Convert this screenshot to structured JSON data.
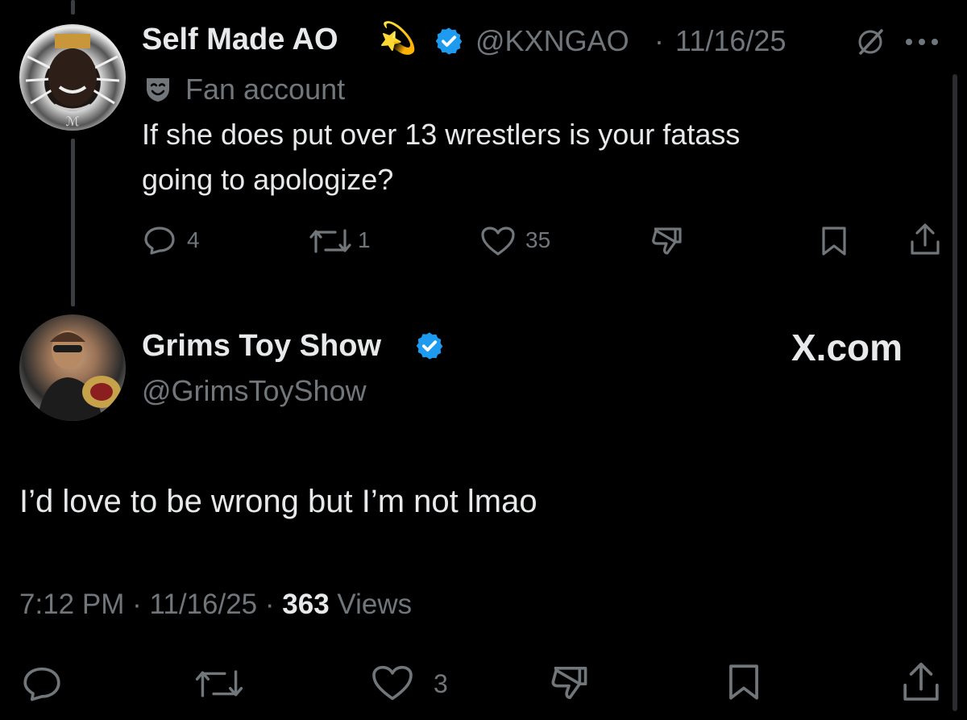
{
  "parent_tweet": {
    "display_name": "Self Made AO",
    "name_emoji": "💫",
    "handle": "@KXNGAO",
    "separator": "·",
    "date": "11/16/25",
    "label": "Fan account",
    "text_line1": "If she does put over 13 wrestlers is your fatass",
    "text_line2": "going to apologize?",
    "replies": "4",
    "reposts": "1",
    "likes": "35"
  },
  "main_tweet": {
    "display_name": "Grims Toy Show",
    "handle": "@GrimsToyShow",
    "watermark": "X.com",
    "text": "I’d love to be wrong but I’m not lmao",
    "time": "7:12 PM",
    "dot1": "·",
    "date": "11/16/25",
    "dot2": "·",
    "views_count": "363",
    "views_label": "Views",
    "likes": "3"
  },
  "colors": {
    "background": "#000000",
    "text": "#e7e9ea",
    "muted": "#71767b",
    "verified": "#1d9bf0"
  },
  "icons": [
    "reply-icon",
    "repost-icon",
    "like-icon",
    "dislike-icon",
    "bookmark-icon",
    "share-icon",
    "verified-badge-icon",
    "grok-icon",
    "more-icon",
    "fan-account-icon"
  ]
}
